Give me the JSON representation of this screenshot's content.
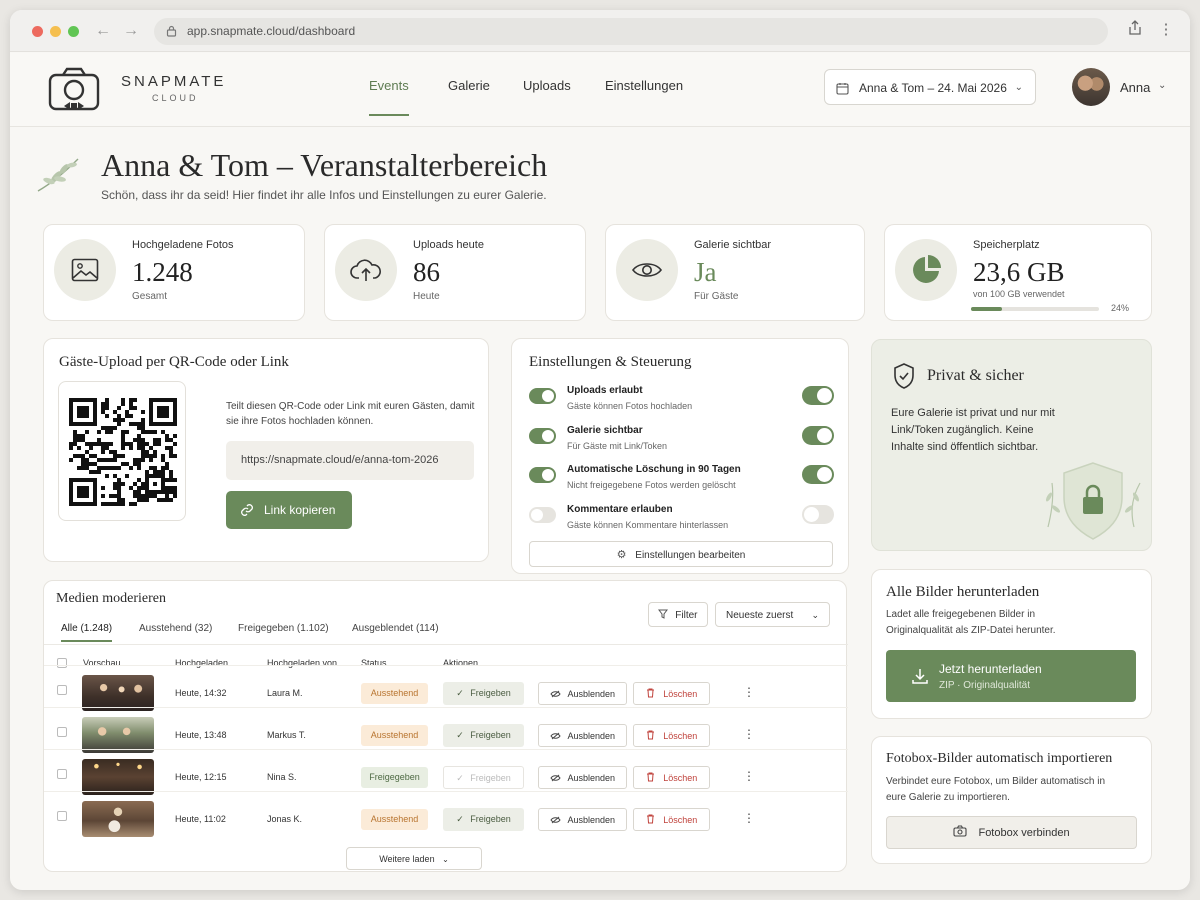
{
  "browser": {
    "url": "app.snapmate.cloud/dashboard"
  },
  "header": {
    "brand": "SNAPMATE",
    "brand_sub": "CLOUD",
    "nav": [
      "Events",
      "Galerie",
      "Uploads",
      "Einstellungen"
    ],
    "event_select": "Anna & Tom – 24. Mai 2026",
    "user": "Anna"
  },
  "page": {
    "title": "Anna & Tom – Veranstalterbereich",
    "subtitle": "Schön, dass ihr da seid! Hier findet ihr alle Infos und Einstellungen zu eurer Galerie."
  },
  "stats": {
    "photos": {
      "label": "Hochgeladene Fotos",
      "value": "1.248",
      "sub": "Gesamt"
    },
    "uploads": {
      "label": "Uploads heute",
      "value": "86",
      "sub": "Heute"
    },
    "visible": {
      "label": "Galerie sichtbar",
      "value": "Ja",
      "sub": "Für Gäste"
    },
    "storage": {
      "label": "Speicherplatz",
      "value": "23,6 GB",
      "sub": "von 100 GB verwendet",
      "percent_label": "24%",
      "percent": 24
    }
  },
  "qr": {
    "title": "Gäste-Upload per QR-Code oder Link",
    "desc": "Teilt diesen QR-Code oder Link mit euren Gästen, damit sie ihre Fotos hochladen können.",
    "link": "https://snapmate.cloud/e/anna-tom-2026",
    "copy_button": "Link kopieren"
  },
  "settings": {
    "title": "Einstellungen & Steuerung",
    "items": [
      {
        "title": "Uploads erlaubt",
        "desc": "Gäste können Fotos hochladen",
        "on": true
      },
      {
        "title": "Galerie sichtbar",
        "desc": "Für Gäste mit Link/Token",
        "on": true
      },
      {
        "title": "Automatische Löschung in 90 Tagen",
        "desc": "Nicht freigegebene Fotos werden gelöscht",
        "on": true
      },
      {
        "title": "Kommentare erlauben",
        "desc": "Gäste können Kommentare hinterlassen",
        "on": false
      }
    ],
    "edit_button": "Einstellungen bearbeiten"
  },
  "privacy": {
    "title": "Privat & sicher",
    "text": "Eure Galerie ist privat und nur mit Link/Token zugänglich. Keine Inhalte sind öffentlich sichtbar."
  },
  "download": {
    "title": "Alle Bilder herunterladen",
    "desc": "Ladet alle freigegebenen Bilder in Originalqualität als ZIP-Datei herunter.",
    "button": "Jetzt herunterladen",
    "button_sub": "ZIP · Originalqualität"
  },
  "fotobox": {
    "title": "Fotobox-Bilder automatisch importieren",
    "desc": "Verbindet eure Fotobox, um Bilder automatisch in eure Galerie zu importieren.",
    "button": "Fotobox verbinden"
  },
  "moderation": {
    "title": "Medien moderieren",
    "tabs": [
      "Alle (1.248)",
      "Ausstehend (32)",
      "Freigegeben (1.102)",
      "Ausgeblendet (114)"
    ],
    "filter": "Filter",
    "sort": "Neueste zuerst",
    "columns": [
      "Vorschau",
      "Hochgeladen",
      "Hochgeladen von",
      "Status",
      "Aktionen"
    ],
    "approve": "Freigeben",
    "hide": "Ausblenden",
    "delete": "Löschen",
    "more": "Weitere laden",
    "rows": [
      {
        "time": "Heute, 14:32",
        "by": "Laura M.",
        "status": "Ausstehend"
      },
      {
        "time": "Heute, 13:48",
        "by": "Markus T.",
        "status": "Ausstehend"
      },
      {
        "time": "Heute, 12:15",
        "by": "Nina S.",
        "status": "Freigegeben"
      },
      {
        "time": "Heute, 11:02",
        "by": "Jonas K.",
        "status": "Ausstehend"
      }
    ]
  }
}
